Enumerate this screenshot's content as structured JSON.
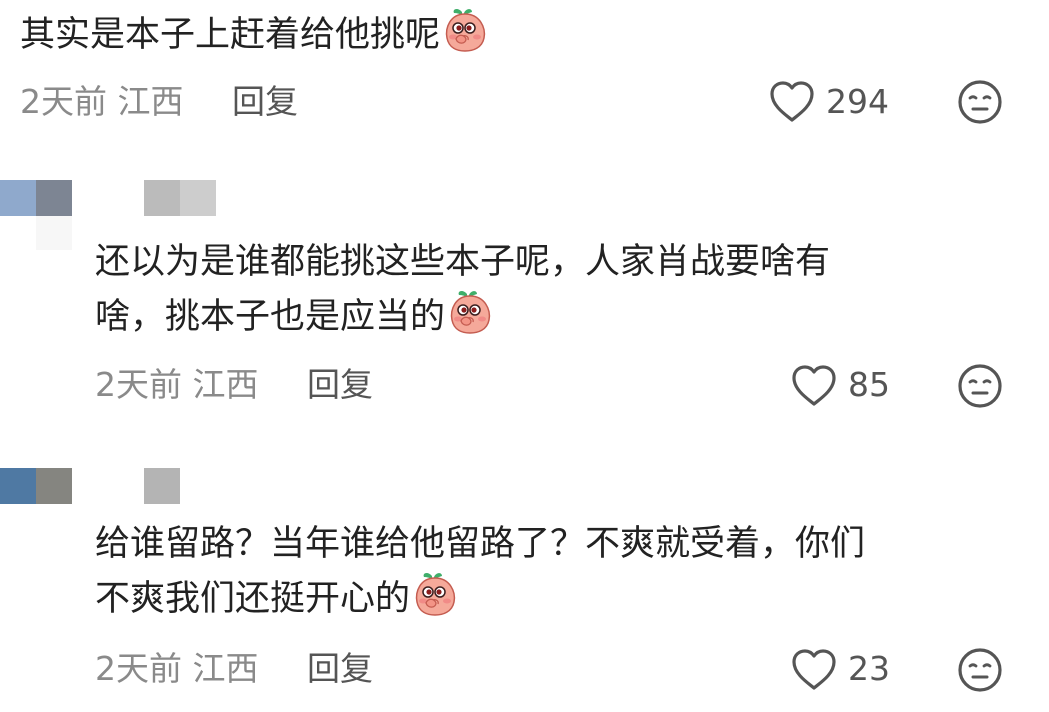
{
  "comments": [
    {
      "lines": [
        "其实是本子上赶着给他挑呢"
      ],
      "emoji": "peach-cover-mouth-emoji",
      "time": "2天前",
      "location": "江西",
      "reply_label": "回复",
      "likes": "294"
    },
    {
      "lines": [
        "还以为是谁都能挑这些本子呢，人家肖战要啥有",
        "啥，挑本子也是应当的"
      ],
      "emoji": "peach-cover-mouth-emoji",
      "time": "2天前",
      "location": "江西",
      "reply_label": "回复",
      "likes": "85"
    },
    {
      "lines": [
        "给谁留路？当年谁给他留路了？不爽就受着，你们",
        "不爽我们还挺开心的"
      ],
      "emoji": "peach-cover-mouth-emoji",
      "time": "2天前",
      "location": "江西",
      "reply_label": "回复",
      "likes": "23"
    }
  ],
  "icons": {
    "like": "heart-outline-icon",
    "dislike": "neutral-face-icon"
  },
  "colors": {
    "text": "#222222",
    "meta": "#8a8a8a",
    "icon": "#555555",
    "emoji_skin": "#f5a99a",
    "emoji_leaf": "#3fae6a"
  }
}
